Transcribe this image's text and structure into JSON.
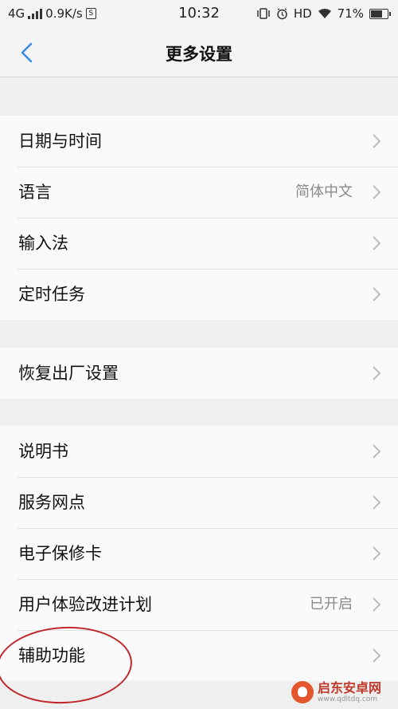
{
  "status_bar": {
    "network": "4G",
    "speed": "0.9K/s",
    "sim_icon_label": "S",
    "time": "10:32",
    "hd": "HD",
    "battery": "71%"
  },
  "header": {
    "title": "更多设置"
  },
  "groups": [
    {
      "rows": [
        {
          "label": "日期与时间",
          "value": ""
        },
        {
          "label": "语言",
          "value": "简体中文"
        },
        {
          "label": "输入法",
          "value": ""
        },
        {
          "label": "定时任务",
          "value": ""
        }
      ]
    },
    {
      "rows": [
        {
          "label": "恢复出厂设置",
          "value": ""
        }
      ]
    },
    {
      "rows": [
        {
          "label": "说明书",
          "value": ""
        },
        {
          "label": "服务网点",
          "value": ""
        },
        {
          "label": "电子保修卡",
          "value": ""
        },
        {
          "label": "用户体验改进计划",
          "value": "已开启"
        },
        {
          "label": "辅助功能",
          "value": ""
        }
      ]
    }
  ],
  "watermark": {
    "title": "启东安卓网",
    "url": "www.qdltdq.com"
  },
  "colors": {
    "accent_back": "#3a8de0",
    "annotation": "#c0282c"
  }
}
